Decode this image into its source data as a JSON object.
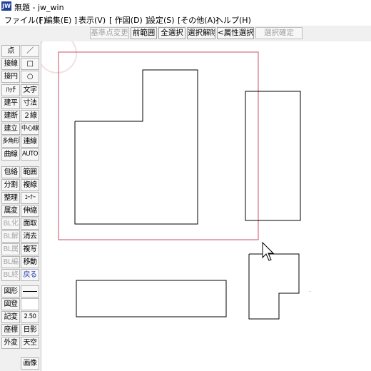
{
  "window": {
    "title": "無題 - jw_win",
    "app_icon_text": "JW"
  },
  "menu": [
    "ファイル(F)",
    "[ 編集(E) ]",
    "表示(V)",
    "[ 作図(D) ]",
    "設定(S)",
    "[その他(A)]",
    "ヘルプ(H)"
  ],
  "command_bar": [
    {
      "label": "基準点変更",
      "enabled": false
    },
    {
      "label": "前範囲",
      "enabled": true
    },
    {
      "label": "全選択",
      "enabled": true
    },
    {
      "label": "選択解除",
      "enabled": true
    },
    {
      "label": "<属性選択>",
      "enabled": true
    },
    {
      "label": "選択確定",
      "enabled": false
    }
  ],
  "tools_left": [
    {
      "label": "点",
      "enabled": true
    },
    {
      "label": "接線",
      "enabled": true
    },
    {
      "label": "接円",
      "enabled": true
    },
    {
      "label": "ﾊｯﾁ",
      "enabled": true
    },
    {
      "label": "建平",
      "enabled": true
    },
    {
      "label": "建断",
      "enabled": true
    },
    {
      "label": "建立",
      "enabled": true
    },
    {
      "label": "多角形",
      "enabled": true
    },
    {
      "label": "曲線",
      "enabled": true
    },
    {
      "label": "包絡",
      "enabled": true
    },
    {
      "label": "分割",
      "enabled": true
    },
    {
      "label": "整理",
      "enabled": true
    },
    {
      "label": "属変",
      "enabled": true
    },
    {
      "label": "BL化",
      "enabled": false
    },
    {
      "label": "BL解",
      "enabled": false
    },
    {
      "label": "BL属",
      "enabled": false
    },
    {
      "label": "BL編",
      "enabled": false
    },
    {
      "label": "BL終",
      "enabled": false
    },
    {
      "label": "図形",
      "enabled": true
    },
    {
      "label": "図登",
      "enabled": true
    },
    {
      "label": "記変",
      "enabled": true
    },
    {
      "label": "座標",
      "enabled": true
    },
    {
      "label": "外変",
      "enabled": true
    }
  ],
  "tools_right": [
    {
      "label": "／",
      "enabled": true
    },
    {
      "label": "□",
      "enabled": true
    },
    {
      "label": "○",
      "enabled": true
    },
    {
      "label": "文字",
      "enabled": true
    },
    {
      "label": "寸法",
      "enabled": true
    },
    {
      "label": "２線",
      "enabled": true
    },
    {
      "label": "中心線",
      "enabled": true
    },
    {
      "label": "連線",
      "enabled": true
    },
    {
      "label": "AUTO",
      "enabled": true
    },
    {
      "label": "範囲",
      "enabled": true
    },
    {
      "label": "複線",
      "enabled": true
    },
    {
      "label": "ｺｰﾅｰ",
      "enabled": true
    },
    {
      "label": "伸縮",
      "enabled": true
    },
    {
      "label": "面取",
      "enabled": true
    },
    {
      "label": "消去",
      "enabled": true
    },
    {
      "label": "複写",
      "enabled": true
    },
    {
      "label": "移動",
      "enabled": true
    },
    {
      "label": "戻る",
      "enabled": true
    },
    {
      "label": "",
      "enabled": true
    },
    {
      "label": "",
      "enabled": true
    },
    {
      "label": "2.50",
      "enabled": true
    },
    {
      "label": "日影",
      "enabled": true
    },
    {
      "label": "天空",
      "enabled": true
    },
    {
      "label": "画像",
      "enabled": true
    }
  ],
  "colors": {
    "selection_rect": "#c8506a",
    "drawing_line": "#000000",
    "disabled_text": "#a8a8a8",
    "undo_text": "#1f3fb8"
  },
  "cursor_icon": "arrow-pointer-icon"
}
